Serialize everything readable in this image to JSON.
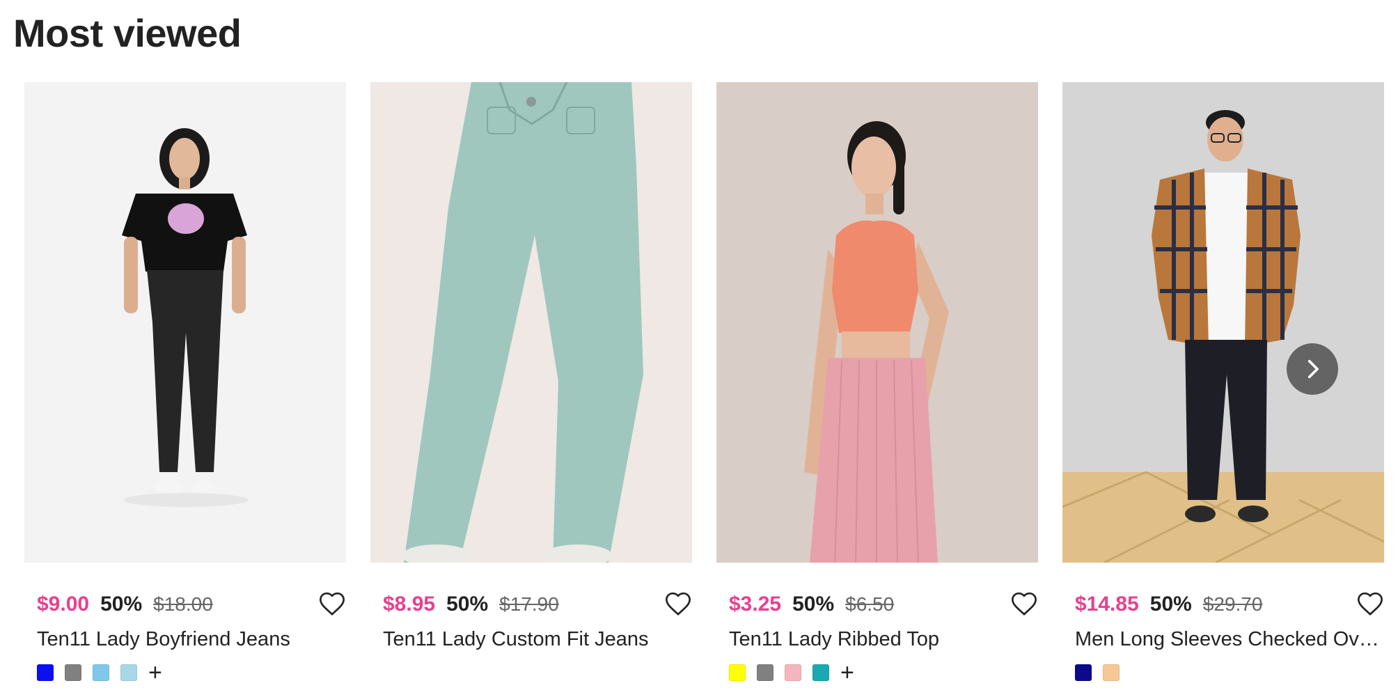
{
  "section": {
    "title": "Most viewed"
  },
  "products": [
    {
      "price": "$9.00",
      "discount": "50%",
      "original_price": "$18.00",
      "name": "Ten11 Lady Boyfriend Jeans",
      "swatches": [
        "#0a10f0",
        "#808080",
        "#7fc8ea",
        "#a8d8e8"
      ],
      "has_more_colors": true,
      "more_label": "+"
    },
    {
      "price": "$8.95",
      "discount": "50%",
      "original_price": "$17.90",
      "name": "Ten11 Lady Custom Fit Jeans",
      "swatches": [],
      "has_more_colors": false,
      "more_label": ""
    },
    {
      "price": "$3.25",
      "discount": "50%",
      "original_price": "$6.50",
      "name": "Ten11 Lady Ribbed Top",
      "swatches": [
        "#ffff00",
        "#808080",
        "#f4b6be",
        "#1aa9b0"
      ],
      "has_more_colors": true,
      "more_label": "+"
    },
    {
      "price": "$14.85",
      "discount": "50%",
      "original_price": "$29.70",
      "name": "Men Long Sleeves Checked Oversh...",
      "swatches": [
        "#0a0a8a",
        "#f6c896"
      ],
      "has_more_colors": false,
      "more_label": ""
    }
  ],
  "icons": {
    "wishlist": "heart-outline-icon",
    "next": "chevron-right-icon"
  },
  "colors": {
    "price": "#e6418f",
    "text": "#222222"
  }
}
